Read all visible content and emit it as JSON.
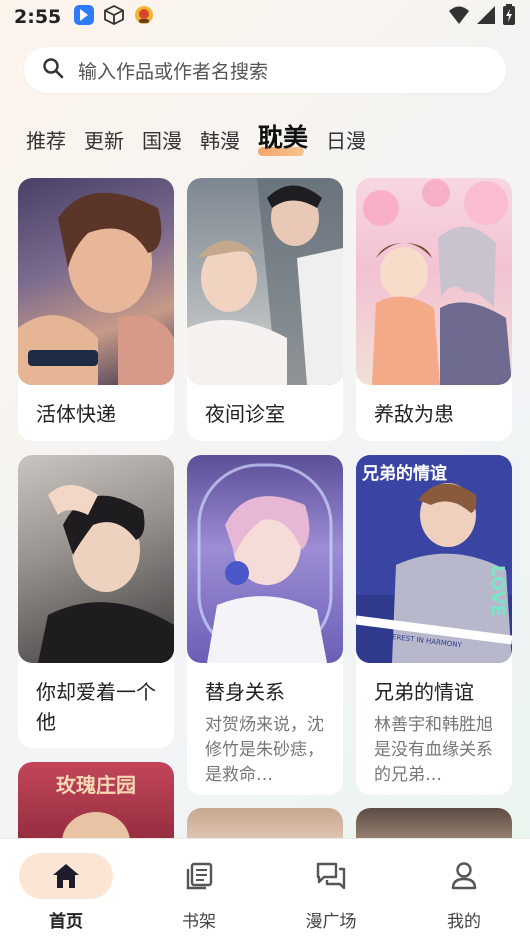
{
  "status_bar": {
    "time": "2:55",
    "icons": [
      "app-notification-icon",
      "box-icon",
      "app-icon",
      "wifi-icon",
      "signal-icon",
      "battery-icon"
    ]
  },
  "search": {
    "placeholder": "输入作品或作者名搜索"
  },
  "tabs": [
    {
      "label": "推荐",
      "active": false
    },
    {
      "label": "更新",
      "active": false
    },
    {
      "label": "国漫",
      "active": false
    },
    {
      "label": "韩漫",
      "active": false
    },
    {
      "label": "耽美",
      "active": true
    },
    {
      "label": "日漫",
      "active": false
    }
  ],
  "cards": [
    {
      "title": "活体快递",
      "desc": ""
    },
    {
      "title": "夜间诊室",
      "desc": ""
    },
    {
      "title": "养敌为患",
      "desc": ""
    },
    {
      "title": "你却爱着一个他",
      "desc": ""
    },
    {
      "title": "替身关系",
      "desc": "对贺炀来说，沈修竹是朱砂痣，是救命…"
    },
    {
      "title": "兄弟的情谊",
      "desc": "林善宇和韩胜旭是没有血缘关系的兄弟…"
    },
    {
      "title": "",
      "desc": "",
      "cover_text": "玫瑰庄园"
    },
    {
      "title": "",
      "desc": ""
    },
    {
      "title": "",
      "desc": ""
    }
  ],
  "cover_overlays": {
    "brothers_title": "兄弟的情谊",
    "brothers_love": "LOVE",
    "brothers_tagline": "LOVE INTEREST IN HARMONY"
  },
  "bottom_nav": [
    {
      "label": "首页",
      "icon": "home-icon",
      "active": true
    },
    {
      "label": "书架",
      "icon": "bookshelf-icon",
      "active": false
    },
    {
      "label": "漫广场",
      "icon": "forum-icon",
      "active": false
    },
    {
      "label": "我的",
      "icon": "profile-icon",
      "active": false
    }
  ],
  "colors": {
    "accent": "#f6a46b",
    "nav_active_bg": "#fde5d6"
  }
}
